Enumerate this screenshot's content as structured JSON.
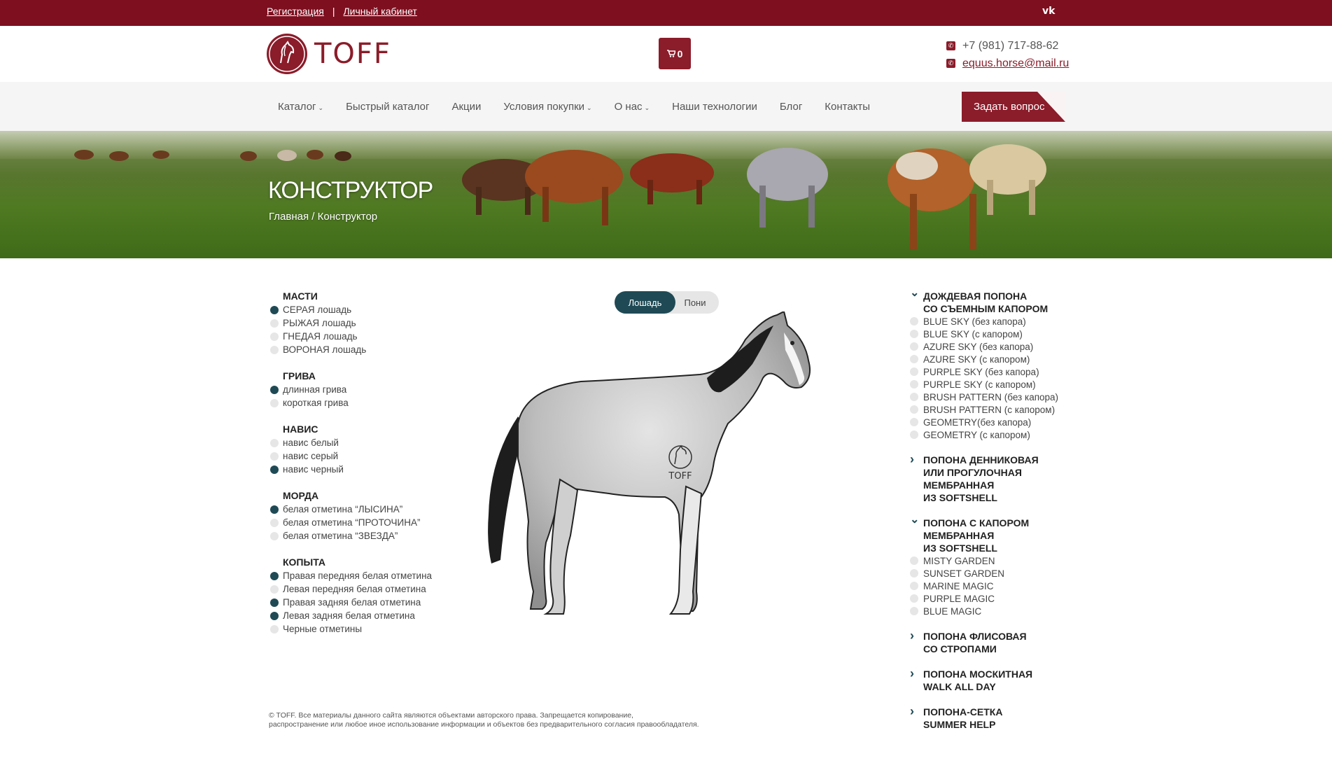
{
  "topbar": {
    "register": "Регистрация",
    "separator": "|",
    "cabinet": "Личный кабинет",
    "vk": "vk"
  },
  "header": {
    "logo_text": "TOFF",
    "cart_count": "0",
    "phone": "+7 (981) 717-88-62",
    "email": "equus.horse@mail.ru"
  },
  "nav": {
    "items": [
      {
        "label": "Каталог",
        "dropdown": true
      },
      {
        "label": "Быстрый каталог",
        "dropdown": false
      },
      {
        "label": "Акции",
        "dropdown": false
      },
      {
        "label": "Условия покупки",
        "dropdown": true
      },
      {
        "label": "О нас",
        "dropdown": true
      },
      {
        "label": "Наши технологии",
        "dropdown": false
      },
      {
        "label": "Блог",
        "dropdown": false
      },
      {
        "label": "Контакты",
        "dropdown": false
      }
    ],
    "ask_button": "Задать вопрос"
  },
  "hero": {
    "title": "КОНСТРУКТОР",
    "breadcrumb_home": "Главная",
    "breadcrumb_sep": " / ",
    "breadcrumb_current": "Конструктор"
  },
  "options": {
    "masti": {
      "title": "МАСТИ",
      "items": [
        {
          "label": "СЕРАЯ лошадь",
          "selected": true
        },
        {
          "label": "РЫЖАЯ лошадь",
          "selected": false
        },
        {
          "label": "ГНЕДАЯ лошадь",
          "selected": false
        },
        {
          "label": "ВОРОНАЯ лошадь",
          "selected": false
        }
      ]
    },
    "griva": {
      "title": "ГРИВА",
      "items": [
        {
          "label": "длинная грива",
          "selected": true
        },
        {
          "label": "короткая грива",
          "selected": false
        }
      ]
    },
    "navis": {
      "title": "НАВИС",
      "items": [
        {
          "label": "навис белый",
          "selected": false
        },
        {
          "label": "навис серый",
          "selected": false
        },
        {
          "label": "навис черный",
          "selected": true
        }
      ]
    },
    "morda": {
      "title": "МОРДА",
      "items": [
        {
          "label": "белая отметина “ЛЫСИНА”",
          "selected": true
        },
        {
          "label": "белая отметина “ПРОТОЧИНА”",
          "selected": false
        },
        {
          "label": "белая отметина “ЗВЕЗДА”",
          "selected": false
        }
      ]
    },
    "kopyta": {
      "title": "КОПЫТА",
      "items": [
        {
          "label": "Правая передняя белая отметина",
          "selected": true
        },
        {
          "label": "Левая передняя белая отметина",
          "selected": false
        },
        {
          "label": "Правая задняя белая отметина",
          "selected": true
        },
        {
          "label": "Левая задняя белая отметина",
          "selected": true
        },
        {
          "label": "Черные отметины",
          "selected": false
        }
      ]
    }
  },
  "toggle": {
    "horse": "Лошадь",
    "pony": "Пони",
    "active": "horse"
  },
  "horse_logo": "TOFF",
  "products": {
    "rain": {
      "title_lines": [
        "ДОЖДЕВАЯ ПОПОНА",
        "СО СЪЕМНЫМ КАПОРОМ"
      ],
      "expanded": true,
      "items": [
        "BLUE SKY (без капора)",
        "BLUE SKY (с капором)",
        "AZURE SKY  (без капора)",
        "AZURE SKY (с капором)",
        "PURPLE SKY (без капора)",
        "PURPLE SKY (с капором)",
        "BRUSH PATTERN (без капора)",
        "BRUSH PATTERN (с капором)",
        "GEOMETRY(без капора)",
        "GEOMETRY (с капором)"
      ]
    },
    "stable": {
      "title_lines": [
        "ПОПОНА ДЕННИКОВАЯ",
        "ИЛИ ПРОГУЛОЧНАЯ",
        "МЕМБРАННАЯ",
        "ИЗ SOFTSHELL"
      ],
      "expanded": false
    },
    "hood": {
      "title_lines": [
        "ПОПОНА С КАПОРОМ",
        "МЕМБРАННАЯ",
        "ИЗ SOFTSHELL"
      ],
      "expanded": true,
      "items": [
        "MISTY GARDEN",
        "SUNSET GARDEN",
        "MARINE MAGIC",
        "PURPLE MAGIC",
        "BLUE MAGIC"
      ]
    },
    "fleece": {
      "title_lines": [
        "ПОПОНА ФЛИСОВАЯ",
        "СО СТРОПАМИ"
      ],
      "expanded": false
    },
    "mosquito": {
      "title_lines": [
        "ПОПОНА МОСКИТНАЯ",
        "WALK ALL DAY"
      ],
      "expanded": false
    },
    "net": {
      "title_lines": [
        "ПОПОНА-СЕТКА",
        "SUMMER HELP"
      ],
      "expanded": false
    }
  },
  "footer": {
    "line1": "© TOFF. Все материалы данного сайта являются объектами авторского права. Запрещается копирование,",
    "line2": "распространение или любое иное использование информации и объектов без предварительного согласия правообладателя."
  },
  "colors": {
    "brand": "#7d0f1f",
    "accent": "#1f4a55"
  }
}
